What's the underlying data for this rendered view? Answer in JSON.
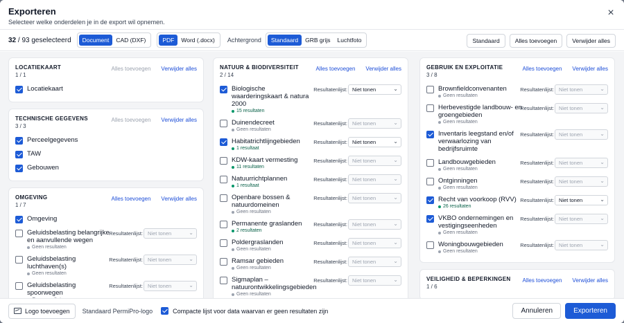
{
  "header": {
    "title": "Exporteren",
    "subtitle": "Selecteer welke onderdelen je in de export wil opnemen."
  },
  "toolbar": {
    "count_selected": "32",
    "count_total": "/ 93 geselecteerd",
    "format_options": [
      "Document",
      "CAD (DXF)"
    ],
    "file_options": [
      "PDF",
      "Word (.docx)"
    ],
    "background_label": "Achtergrond",
    "background_options": [
      "Standaard",
      "GRB grijs",
      "Luchtfoto"
    ],
    "standard_label": "Standaard",
    "add_all_label": "Alles toevoegen",
    "remove_all_label": "Verwijder alles"
  },
  "labels": {
    "add_all": "Alles toevoegen",
    "remove_all": "Verwijder alles",
    "results_list": "Resultatenlijst:",
    "no_show": "Niet tonen"
  },
  "columns": [
    {
      "cards": [
        {
          "title": "LOCATIEKAART",
          "count": "1 / 1",
          "add_disabled": true,
          "items": [
            {
              "name": "Locatiekaart",
              "checked": true,
              "simple": true
            }
          ]
        },
        {
          "title": "TECHNISCHE GEGEVENS",
          "count": "3 / 3",
          "add_disabled": true,
          "items": [
            {
              "name": "Perceelgegevens",
              "checked": true,
              "simple": true
            },
            {
              "name": "TAW",
              "checked": true,
              "simple": true
            },
            {
              "name": "Gebouwen",
              "checked": true,
              "simple": true
            }
          ]
        },
        {
          "title": "OMGEVING",
          "count": "1 / 7",
          "add_disabled": false,
          "items": [
            {
              "name": "Omgeving",
              "checked": true,
              "simple": true
            },
            {
              "name": "Geluidsbelasting belangrijke en aanvullende wegen",
              "checked": false,
              "status": "Geen resultaten"
            },
            {
              "name": "Geluidsbelasting luchthaven(s)",
              "checked": false,
              "status": "Geen resultaten"
            },
            {
              "name": "Geluidsbelasting spoorwegen",
              "checked": false,
              "status": "Geen resultaten"
            }
          ]
        }
      ]
    },
    {
      "cards": [
        {
          "title": "NATUUR & BIODIVERSITEIT",
          "count": "2 / 14",
          "add_disabled": false,
          "items": [
            {
              "name": "Biologische waarderingskaart & natura 2000",
              "checked": true,
              "status": "15 resultaten",
              "has_results": true
            },
            {
              "name": "Duinendecreet",
              "checked": false,
              "status": "Geen resultaten"
            },
            {
              "name": "Habitatrichtlijngebieden",
              "checked": true,
              "status": "1 resultaat",
              "has_results": true
            },
            {
              "name": "KDW-kaart vermesting",
              "checked": false,
              "status": "11 resultaten",
              "has_results": true,
              "disabled_select": true
            },
            {
              "name": "Natuurrichtplannen",
              "checked": false,
              "status": "1 resultaat",
              "has_results": true,
              "disabled_select": true
            },
            {
              "name": "Openbare bossen & natuurdomeinen",
              "checked": false,
              "status": "Geen resultaten"
            },
            {
              "name": "Permanente graslanden",
              "checked": false,
              "status": "2 resultaten",
              "has_results": true,
              "disabled_select": true
            },
            {
              "name": "Poldergraslanden",
              "checked": false,
              "status": "Geen resultaten"
            },
            {
              "name": "Ramsar gebieden",
              "checked": false,
              "status": "Geen resultaten"
            },
            {
              "name": "Sigmaplan – natuurontwikkelingsgebieden",
              "checked": false,
              "status": "Geen resultaten"
            }
          ]
        }
      ]
    },
    {
      "cards": [
        {
          "title": "GEBRUIK EN EXPLOITATIE",
          "count": "3 / 8",
          "add_disabled": false,
          "items": [
            {
              "name": "Brownfieldconvenanten",
              "checked": false,
              "status": "Geen resultaten"
            },
            {
              "name": "Herbevestigde landbouw- en groengebieden",
              "checked": false,
              "status": "Geen resultaten"
            },
            {
              "name": "Inventaris leegstand en/of verwaarlozing van bedrijfsruimte",
              "checked": true,
              "status": ""
            },
            {
              "name": "Landbouwgebieden",
              "checked": false,
              "status": "Geen resultaten"
            },
            {
              "name": "Ontginningen",
              "checked": false,
              "status": "Geen resultaten"
            },
            {
              "name": "Recht van voorkoop (RVV)",
              "checked": true,
              "status": "26 resultaten",
              "has_results": true
            },
            {
              "name": "VKBO ondernemingen en vestigingseenheden",
              "checked": true,
              "status": "Geen resultaten"
            },
            {
              "name": "Woningbouwgebieden",
              "checked": false,
              "status": "Geen resultaten"
            }
          ]
        },
        {
          "title": "VEILIGHEID & BEPERKINGEN",
          "count": "1 / 6",
          "add_disabled": false,
          "items": []
        }
      ]
    }
  ],
  "footer": {
    "logo_button": "Logo toevoegen",
    "logo_text": "Standaard PermiPro-logo",
    "compact_label": "Compacte lijst voor data waarvan er geen resultaten zijn",
    "cancel": "Annuleren",
    "export": "Exporteren"
  }
}
